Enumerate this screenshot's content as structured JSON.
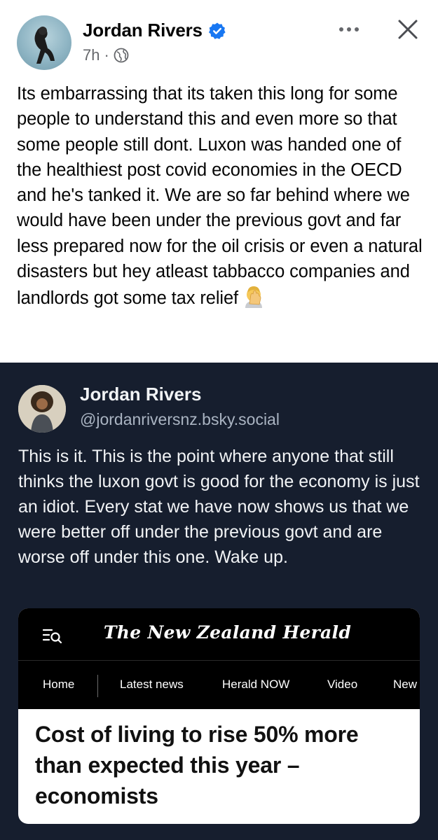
{
  "fb_post": {
    "author": "Jordan Rivers",
    "time": "7h",
    "separator": "·",
    "body": "Its embarrassing that its taken this long for some people to understand this and even more so that some people still dont. Luxon was handed one of the healthiest post covid economies in the OECD and he's tanked it. We are so far behind where we would have been under the previous govt and far less prepared now for the oil crisis or even a natural disasters but hey atleast tabbacco companies and landlords got some tax relief",
    "emoji": "facepalm-emoji",
    "icons": {
      "verified": "verified-badge-icon",
      "audience": "globe-icon",
      "more": "more-options-icon",
      "close": "close-icon"
    },
    "colors": {
      "verified_blue": "#1877f2",
      "meta_gray": "#65676b"
    }
  },
  "bsky_post": {
    "author": "Jordan Rivers",
    "handle": "@jordanriversnz.bsky.social",
    "body": "This is it. This is the point where anyone that still thinks the luxon govt is good for the economy is just an idiot. Every stat we have now shows us that we were better off under the previous govt and are worse off under this one. Wake up.",
    "colors": {
      "background": "#161e2e",
      "text": "#f1f3f5",
      "handle": "#aab4c2"
    }
  },
  "news_card": {
    "masthead": "The New Zealand Herald",
    "menu_icon": "menu-search-icon",
    "nav": [
      "Home",
      "Latest news",
      "Herald NOW",
      "Video",
      "New"
    ],
    "headline": "Cost of living to rise 50% more than expected this year – economists"
  }
}
